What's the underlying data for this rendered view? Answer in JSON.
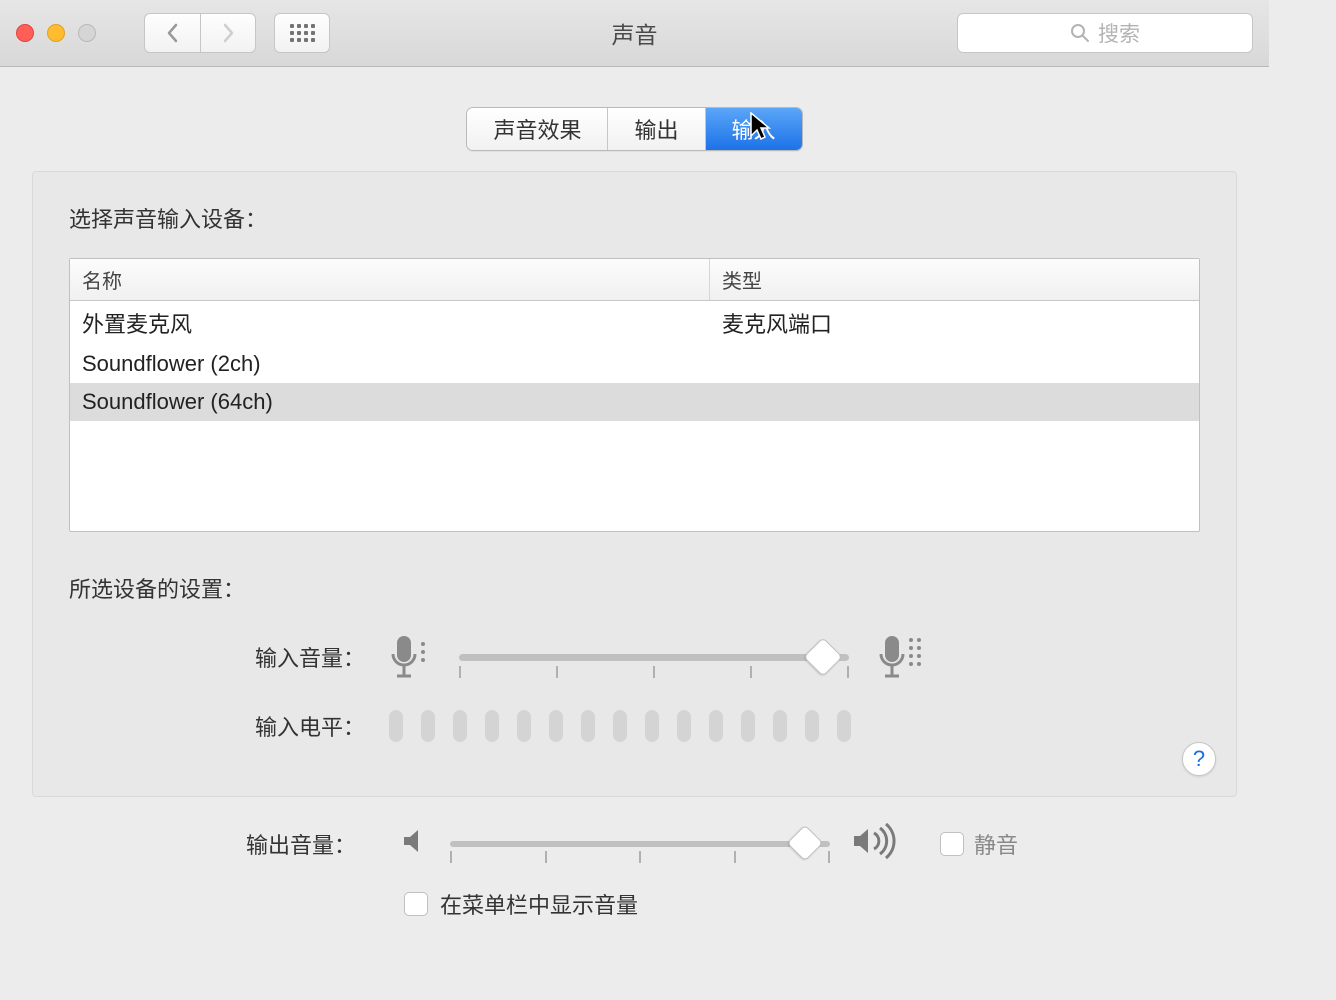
{
  "window": {
    "title": "声音"
  },
  "search": {
    "placeholder": "搜索"
  },
  "tabs": [
    {
      "label": "声音效果",
      "active": false
    },
    {
      "label": "输出",
      "active": false
    },
    {
      "label": "输入",
      "active": true
    }
  ],
  "section": {
    "select_device_label": "选择声音输入设备：",
    "columns": {
      "name": "名称",
      "type": "类型"
    },
    "devices": [
      {
        "name": "外置麦克风",
        "type": "麦克风端口",
        "selected": false
      },
      {
        "name": "Soundflower (2ch)",
        "type": "",
        "selected": false
      },
      {
        "name": "Soundflower (64ch)",
        "type": "",
        "selected": true
      }
    ]
  },
  "settings": {
    "header": "所选设备的设置：",
    "input_volume_label": "输入音量：",
    "input_level_label": "输入电平：",
    "level_segments": 15
  },
  "output": {
    "volume_label": "输出音量：",
    "mute_label": "静音",
    "show_in_menubar_label": "在菜单栏中显示音量"
  },
  "help": "?"
}
